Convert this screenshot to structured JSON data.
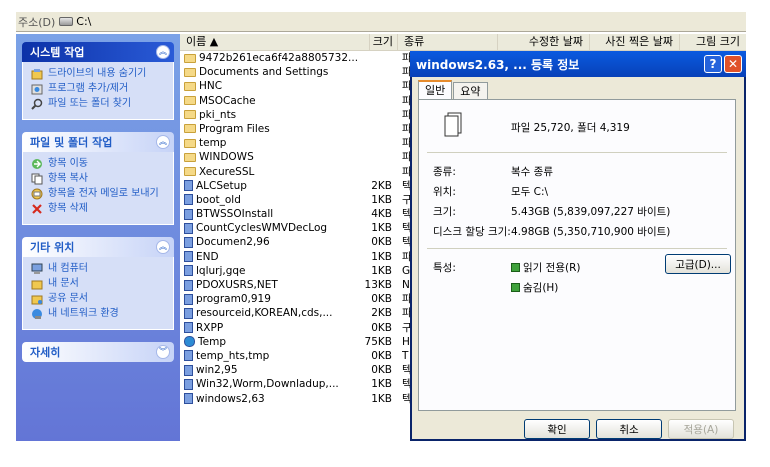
{
  "address_bar": {
    "label": "주소(D)",
    "path": "C:\\"
  },
  "task_pane": {
    "system_tasks": {
      "title": "시스템 작업",
      "items": [
        "드라이브의 내용 숨기기",
        "프로그램 추가/제거",
        "파일 또는 폴더 찾기"
      ]
    },
    "file_tasks": {
      "title": "파일 및 폴더 작업",
      "items": [
        "항목 이동",
        "항목 복사",
        "항목을 전자 메일로 보내기",
        "항목 삭제"
      ]
    },
    "other_places": {
      "title": "기타 위치",
      "items": [
        "내 컴퓨터",
        "내 문서",
        "공유 문서",
        "내 네트워크 환경"
      ]
    },
    "details": {
      "title": "자세히"
    }
  },
  "file_list": {
    "columns": [
      "이름 ▲",
      "크기",
      "종류",
      "수정한 날짜",
      "사진 찍은 날짜",
      "그림 크기"
    ],
    "rows": [
      {
        "name": "9472b261eca6f42a8805732...",
        "size": "",
        "type": "파",
        "icon": "folder"
      },
      {
        "name": "Documents and Settings",
        "size": "",
        "type": "파",
        "icon": "folder"
      },
      {
        "name": "HNC",
        "size": "",
        "type": "파",
        "icon": "folder"
      },
      {
        "name": "MSOCache",
        "size": "",
        "type": "파",
        "icon": "folder"
      },
      {
        "name": "pki_nts",
        "size": "",
        "type": "파",
        "icon": "folder"
      },
      {
        "name": "Program Files",
        "size": "",
        "type": "파",
        "icon": "folder"
      },
      {
        "name": "temp",
        "size": "",
        "type": "파",
        "icon": "folder"
      },
      {
        "name": "WINDOWS",
        "size": "",
        "type": "파",
        "icon": "folder"
      },
      {
        "name": "XecureSSL",
        "size": "",
        "type": "파",
        "icon": "folder"
      },
      {
        "name": "ALCSetup",
        "size": "2KB",
        "type": "텍",
        "icon": "file"
      },
      {
        "name": "boot_old",
        "size": "1KB",
        "type": "구",
        "icon": "file"
      },
      {
        "name": "BTWSSOInstall",
        "size": "4KB",
        "type": "텍",
        "icon": "file"
      },
      {
        "name": "CountCyclesWMVDecLog",
        "size": "1KB",
        "type": "텍",
        "icon": "file"
      },
      {
        "name": "Documen2,96",
        "size": "0KB",
        "type": "텍",
        "icon": "file"
      },
      {
        "name": "END",
        "size": "1KB",
        "type": "파",
        "icon": "file"
      },
      {
        "name": "lqlurj,gqe",
        "size": "1KB",
        "type": "G",
        "icon": "file"
      },
      {
        "name": "PDOXUSRS,NET",
        "size": "13KB",
        "type": "N",
        "icon": "file"
      },
      {
        "name": "program0,919",
        "size": "0KB",
        "type": "파",
        "icon": "file"
      },
      {
        "name": "resourceid,KOREAN,cds,...",
        "size": "2KB",
        "type": "파",
        "icon": "file"
      },
      {
        "name": "RXPP",
        "size": "0KB",
        "type": "구",
        "icon": "file"
      },
      {
        "name": "Temp",
        "size": "75KB",
        "type": "H",
        "icon": "help"
      },
      {
        "name": "temp_hts,tmp",
        "size": "0KB",
        "type": "T",
        "icon": "file"
      },
      {
        "name": "win2,95",
        "size": "0KB",
        "type": "텍",
        "icon": "file"
      },
      {
        "name": "Win32,Worm,Downladup,...",
        "size": "1KB",
        "type": "텍",
        "icon": "file"
      },
      {
        "name": "windows2,63",
        "size": "1KB",
        "type": "텍",
        "icon": "file"
      }
    ]
  },
  "dialog": {
    "title": "windows2.63, ... 등록 정보",
    "help_button": "?",
    "close_button": "✕",
    "tabs": [
      "일반",
      "요약"
    ],
    "summary": "파일 25,720, 폴더 4,319",
    "type_label": "종류:",
    "type_value": "복수 종류",
    "location_label": "위치:",
    "location_value": "모두 C:\\",
    "size_label": "크기:",
    "size_value": "5.43GB (5,839,097,227 바이트)",
    "disk_label": "디스크 할당 크기:",
    "disk_value": "4.98GB (5,350,710,900 바이트)",
    "attr_label": "특성:",
    "readonly_label": "읽기 전용(R)",
    "hidden_label": "숨김(H)",
    "advanced_button": "고급(D)...",
    "ok_button": "확인",
    "cancel_button": "취소",
    "apply_button": "적용(A)"
  }
}
